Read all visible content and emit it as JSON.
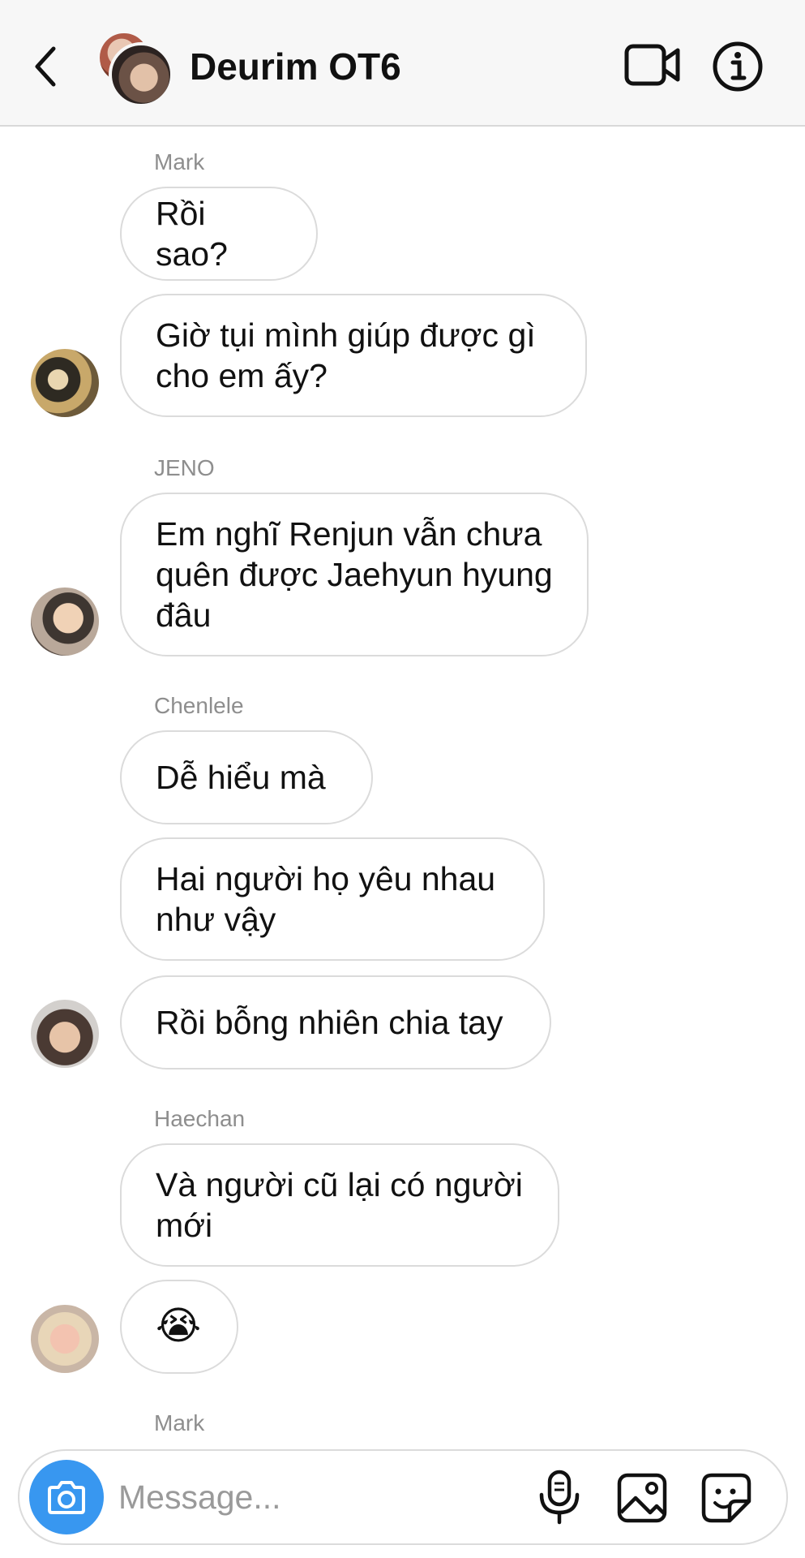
{
  "header": {
    "title": "Deurim OT6",
    "icons": {
      "back": "chevron-left-icon",
      "video": "video-camera-icon",
      "info": "info-icon"
    }
  },
  "messages": [
    {
      "sender": "Mark",
      "bubbles": [
        "Rồi sao?",
        "Giờ tụi mình giúp được gì cho em ấy?"
      ]
    },
    {
      "sender": "JENO",
      "bubbles": [
        "Em nghĩ Renjun vẫn chưa quên được Jaehyun hyung đâu"
      ]
    },
    {
      "sender": "Chenlele",
      "bubbles": [
        "Dễ hiểu mà",
        "Hai người họ yêu nhau như vậy",
        "Rồi bỗng nhiên chia tay"
      ]
    },
    {
      "sender": "Haechan",
      "bubbles": [
        "Và người cũ lại có người mới",
        "😭"
      ]
    },
    {
      "sender": "Mark",
      "bubbles": []
    }
  ],
  "composer": {
    "placeholder": "Message...",
    "icons": {
      "camera": "camera-icon",
      "mic": "microphone-icon",
      "gallery": "image-icon",
      "sticker": "sticker-icon"
    },
    "accent_color": "#3897f0"
  }
}
